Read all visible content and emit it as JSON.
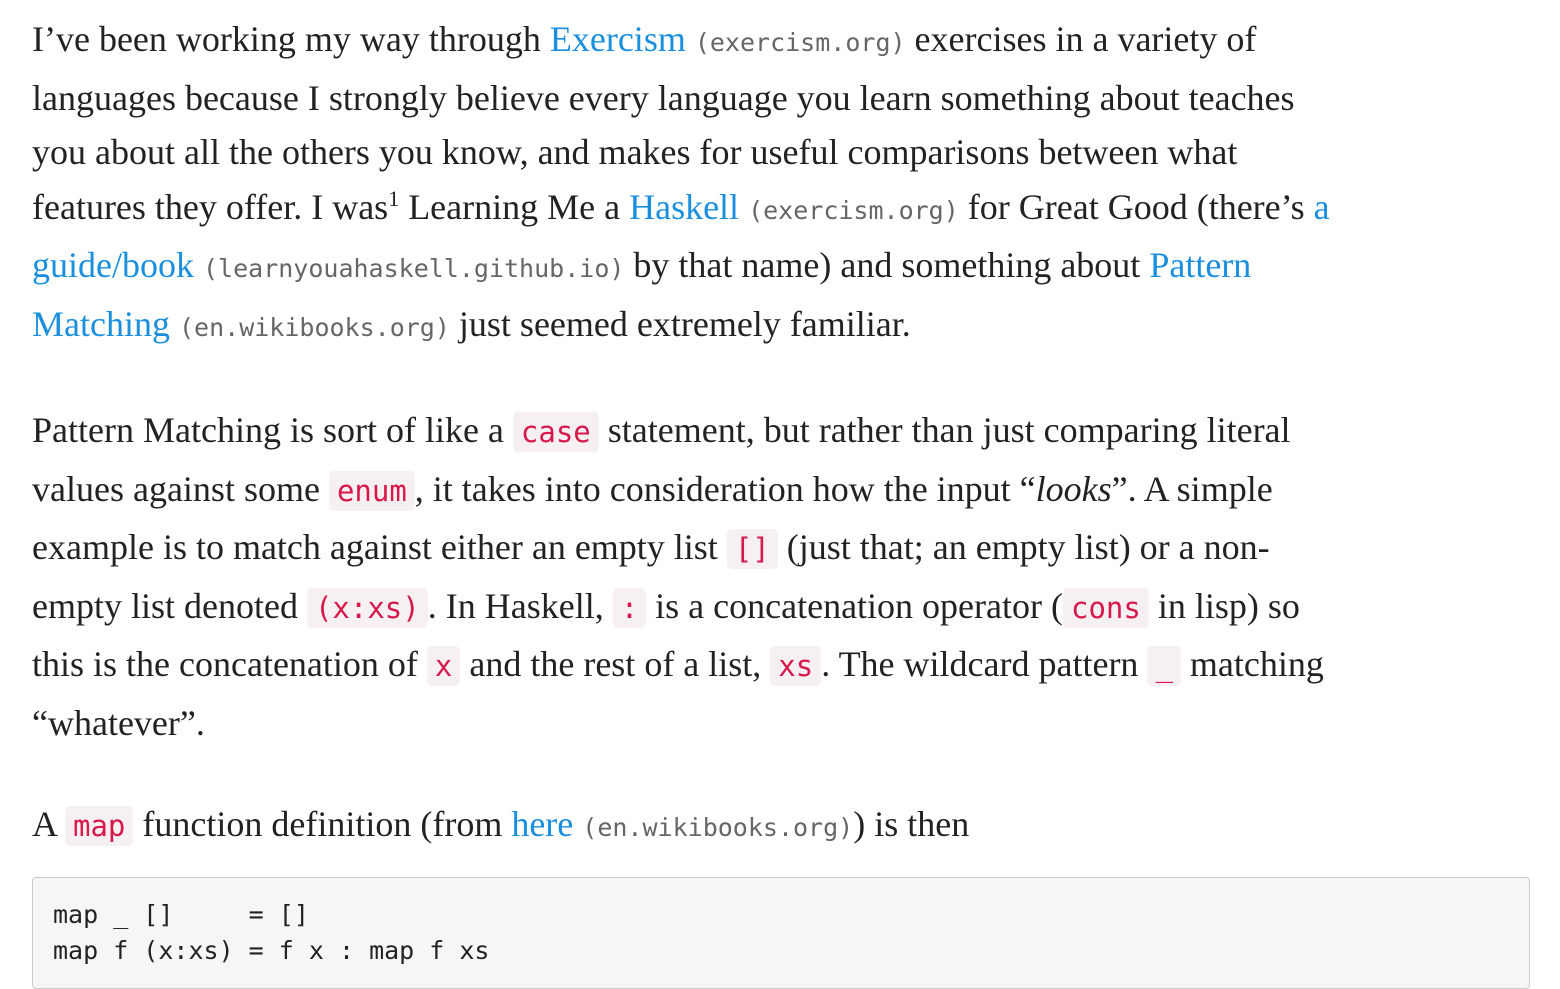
{
  "p1": {
    "t1": "I’ve been working my way through ",
    "exercism_link": "Exercism",
    "exercism_domain": "(exercism.org)",
    "t2": " exercises in a variety of",
    "t3": "languages because I strongly believe every language you learn something about teaches",
    "t4": "you about all the others you know, and makes for useful comparisons between what",
    "t5": "features they offer. I was",
    "footnote": "1",
    "t6": " Learning Me a ",
    "haskell_link": "Haskell",
    "haskell_domain": "(exercism.org)",
    "t7": " for Great Good (there’s ",
    "guide_link_a": "a",
    "guide_link_b": "guide/book",
    "guide_domain": "(learnyouahaskell.github.io)",
    "t8": " by that name) and something about ",
    "pm_link_a": "Pattern",
    "pm_link_b": "Matching",
    "pm_domain": "(en.wikibooks.org)",
    "t9": " just seemed extremely familiar."
  },
  "p2": {
    "t1": "Pattern Matching is sort of like a ",
    "c_case": "case",
    "t2": " statement, but rather than just comparing literal",
    "t3": "values against some ",
    "c_enum": "enum",
    "t4": ", it takes into consideration how the input “",
    "looks": "looks",
    "t5": "”. A simple",
    "t6": "example is to match against either an empty list ",
    "c_empty": "[]",
    "t7": " (just that; an empty list) or a non-",
    "t8": "empty list denoted ",
    "c_xxs": "(x:xs)",
    "t9": ". In Haskell, ",
    "c_colon": ":",
    "t10": " is a concatenation operator (",
    "c_cons": "cons",
    "t11": " in lisp) so",
    "t12": "this is the concatenation of ",
    "c_x": "x",
    "t13": " and the rest of a list, ",
    "c_xs": "xs",
    "t14": ". The wildcard pattern ",
    "c_wild": "_",
    "t15": " matching",
    "t16": "“whatever”."
  },
  "p3": {
    "t1": "A ",
    "c_map": "map",
    "t2": " function definition (from ",
    "here_link": "here",
    "here_domain": "(en.wikibooks.org)",
    "t3": ") is then"
  },
  "code": {
    "line1": "map _ []     = []",
    "line2": "map f (x:xs) = f x : map f xs"
  },
  "colors": {
    "text": "#222222",
    "link": "#1a8fde",
    "domain": "#666666",
    "inline_code": "#d6194a",
    "inline_code_bg": "#f7f0f2",
    "code_block_bg": "#f6f6f6"
  }
}
